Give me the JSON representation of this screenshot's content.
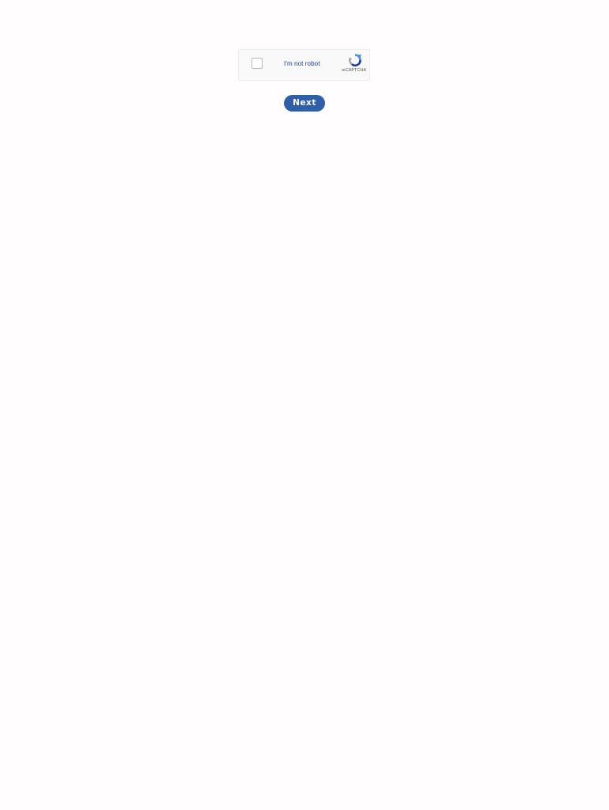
{
  "recaptcha": {
    "label": "I'm not robot",
    "brand": "reCAPTCHA",
    "checked": false,
    "logo_icon": "recaptcha-logo-icon",
    "colors": {
      "label": "#1a3c8b",
      "logo_blue": "#4a90e2",
      "logo_dark": "#1c3aa9",
      "logo_gray": "#a6a6a6"
    }
  },
  "actions": {
    "next_label": "Next",
    "next_color": "#2f5fa8"
  }
}
